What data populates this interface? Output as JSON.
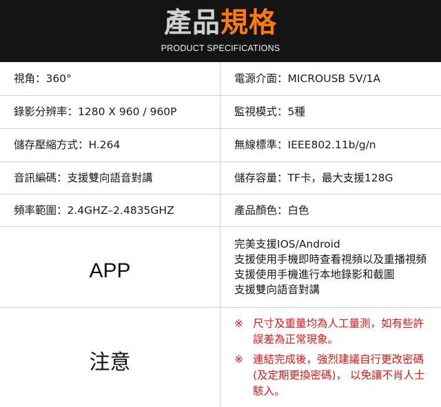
{
  "header": {
    "title_part1": "產品",
    "title_part2": "規格",
    "subtitle": "PRODUCT SPECIFICATIONS"
  },
  "specs": [
    {
      "left": "視角：360°",
      "right": "電源介面：MICROUSB  5V/1A"
    },
    {
      "left": "錄影分辨率：1280 X 960 / 960P",
      "right": "監視模式：5種"
    },
    {
      "left": "儲存壓縮方式：H.264",
      "right": "無線標準：IEEE802.11b/g/n"
    },
    {
      "left": "音訊編碼：支援雙向語音對講",
      "right": "儲存容量：TF卡，最大支援128G"
    },
    {
      "left": "頻率範圍：2.4GHZ–2.4835GHZ",
      "right": "產品顏色：白色"
    }
  ],
  "app": {
    "label": "APP",
    "lines": [
      "完美支援IOS/Android",
      "支援使用手機即時查看視頻以及重播視頻",
      "支援使用手機進行本地錄影和截圖",
      "支援雙向語音對講"
    ]
  },
  "notes": {
    "label": "注意",
    "mark": "※",
    "items": [
      {
        "lines": [
          "尺寸及重量均為人工量測，如有些許",
          "誤差為正常現象。"
        ]
      },
      {
        "lines": [
          "連結完成後，強烈建議自行更改密碼",
          "(及定期更換密碼)， 以免讓不肖人士",
          "駭入。"
        ]
      }
    ]
  },
  "colors": {
    "header_bg": "#141414",
    "title_accent": "#ff7a0f",
    "note_text": "#e11a1a",
    "grid": "#cfcfcf"
  }
}
